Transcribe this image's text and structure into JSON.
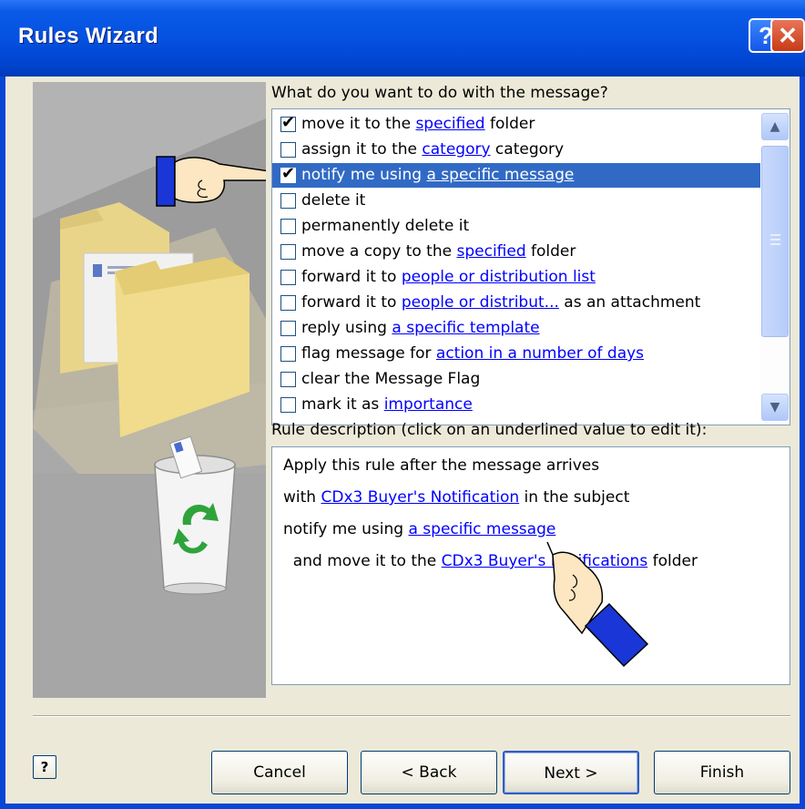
{
  "window": {
    "title": "Rules Wizard",
    "help_glyph": "?",
    "close_glyph": "✕"
  },
  "actions": {
    "prompt": "What do you want to do with the message?",
    "items": [
      {
        "pre": "move it to the ",
        "link": "specified",
        "post": " folder",
        "checked": true
      },
      {
        "pre": "assign it to the ",
        "link": "category",
        "post": " category",
        "checked": false
      },
      {
        "pre": "notify me using ",
        "link": "a specific message",
        "post": "",
        "checked": true,
        "selected": true
      },
      {
        "pre": "delete it",
        "link": "",
        "post": "",
        "checked": false
      },
      {
        "pre": "permanently delete it",
        "link": "",
        "post": "",
        "checked": false
      },
      {
        "pre": "move a copy to the ",
        "link": "specified",
        "post": " folder",
        "checked": false
      },
      {
        "pre": "forward it to ",
        "link": "people or distribution list",
        "post": "",
        "checked": false
      },
      {
        "pre": "forward it to ",
        "link": "people or distribut...",
        "post": " as an attachment",
        "checked": false
      },
      {
        "pre": "reply using ",
        "link": "a specific template",
        "post": "",
        "checked": false
      },
      {
        "pre": "flag message for ",
        "link": "action in a number of days",
        "post": "",
        "checked": false
      },
      {
        "pre": "clear the Message Flag",
        "link": "",
        "post": "",
        "checked": false
      },
      {
        "pre": "mark it as ",
        "link": "importance",
        "post": "",
        "checked": false
      }
    ],
    "scroll_up": "▲",
    "scroll_down": "▼"
  },
  "description": {
    "label": "Rule description (click on an underlined value to edit it):",
    "lines": [
      {
        "pre": "Apply this rule after the message arrives",
        "link": "",
        "post": ""
      },
      {
        "pre": "with ",
        "link": "CDx3 Buyer's Notification",
        "post": " in the subject"
      },
      {
        "pre": "notify me using ",
        "link": "a specific message",
        "post": ""
      },
      {
        "pre": "  and move it to the ",
        "link": "CDx3 Buyer's Notifications",
        "post": " folder"
      }
    ]
  },
  "buttons": {
    "help": "?",
    "cancel": "Cancel",
    "back": "< Back",
    "next": "Next >",
    "finish": "Finish"
  },
  "colors": {
    "titlebar": "#0551e0",
    "selection": "#316ac5",
    "link": "#0000ff",
    "dialog_bg": "#ece9d8"
  }
}
